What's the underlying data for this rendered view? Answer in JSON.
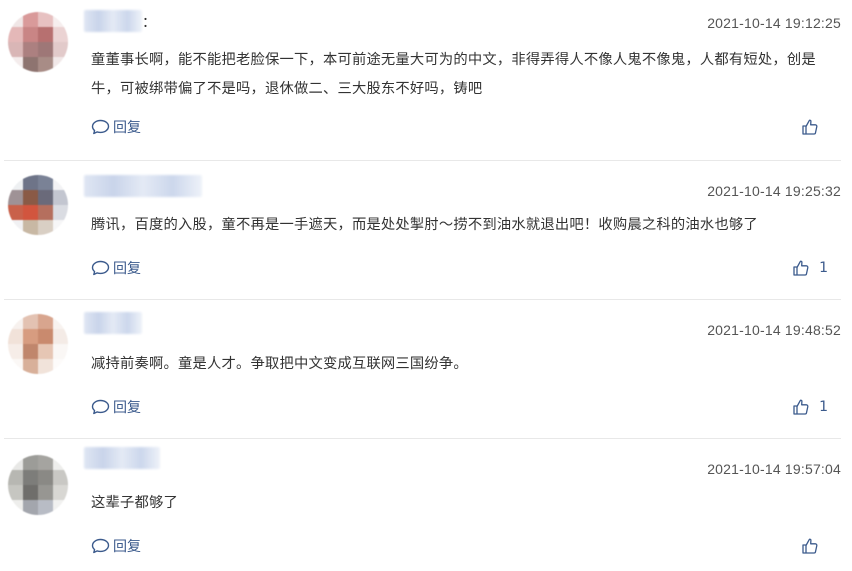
{
  "comments": [
    {
      "username_suffix": "：",
      "timestamp": "2021-10-14 19:12:25",
      "content": "童董事长啊，能不能把老脸保一下，本可前途无量大可为的中文，非得弄得人不像人鬼不像鬼，人都有短处，创是牛，可被绑带偏了不是吗，退休做二、三大股东不好吗，铸吧",
      "reply_label": "回复",
      "like_count": ""
    },
    {
      "username_suffix": "",
      "timestamp": "2021-10-14 19:25:32",
      "content": "腾讯，百度的入股，童不再是一手遮天，而是处处掣肘～捞不到油水就退出吧！收购晨之科的油水也够了",
      "reply_label": "回复",
      "like_count": "1"
    },
    {
      "username_suffix": "",
      "timestamp": "2021-10-14 19:48:52",
      "content": "减持前奏啊。童是人才。争取把中文变成互联网三国纷争。",
      "reply_label": "回复",
      "like_count": "1"
    },
    {
      "username_suffix": "",
      "timestamp": "2021-10-14 19:57:04",
      "content": "这辈子都够了",
      "reply_label": "回复",
      "like_count": ""
    }
  ],
  "colors": {
    "link": "#3b5a8c",
    "text": "#333333",
    "timestamp": "#555555",
    "divider": "#e8e8e8"
  },
  "icons": {
    "reply": "speech-bubble-icon",
    "like": "thumbs-up-icon"
  }
}
